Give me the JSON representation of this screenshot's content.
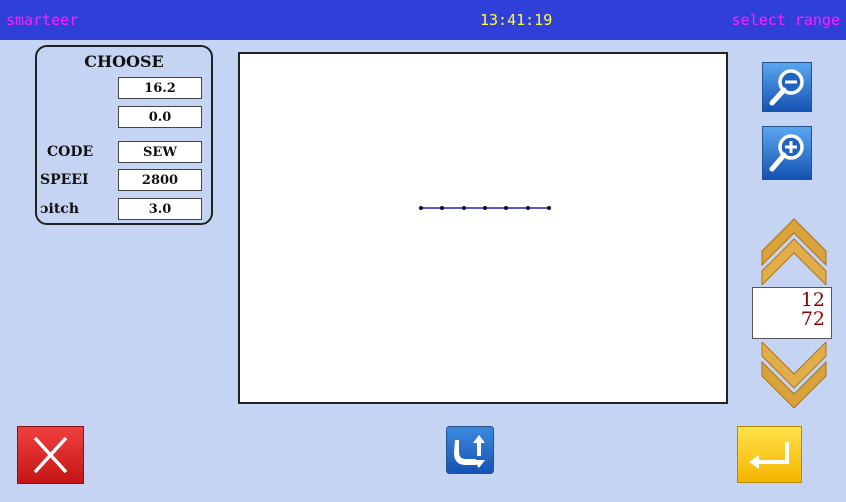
{
  "header": {
    "app_name": "smarteer",
    "time": "13:41:19",
    "mode": "select range"
  },
  "panel": {
    "title": "CHOOSE",
    "rows": [
      {
        "label": "",
        "value": "16.2"
      },
      {
        "label": "",
        "value": "0.0"
      },
      {
        "label": "CODE",
        "value": "SEW"
      },
      {
        "label": "SPEEI",
        "value": "2800"
      },
      {
        "label": "ɔitch",
        "value": "3.0"
      }
    ]
  },
  "pager": {
    "current": "12",
    "total": "72"
  },
  "icons": {
    "zoom_out": "zoom-out-icon",
    "zoom_in": "zoom-in-icon",
    "page_up": "chevron-up-icon",
    "page_down": "chevron-down-icon",
    "cancel": "close-icon",
    "mode_switch": "path-switch-icon",
    "enter": "enter-icon"
  },
  "colors": {
    "background": "#c5d4f2",
    "header_bar": "#2f3fd8",
    "header_text_magenta": "#ff22ff",
    "header_text_yellow": "#ffff33",
    "cancel_red": "#e02020",
    "enter_yellow": "#ffcc00",
    "button_blue": "#1f6fd0",
    "chevron_gold": "#d9a23a",
    "pager_text": "#8b0000"
  }
}
